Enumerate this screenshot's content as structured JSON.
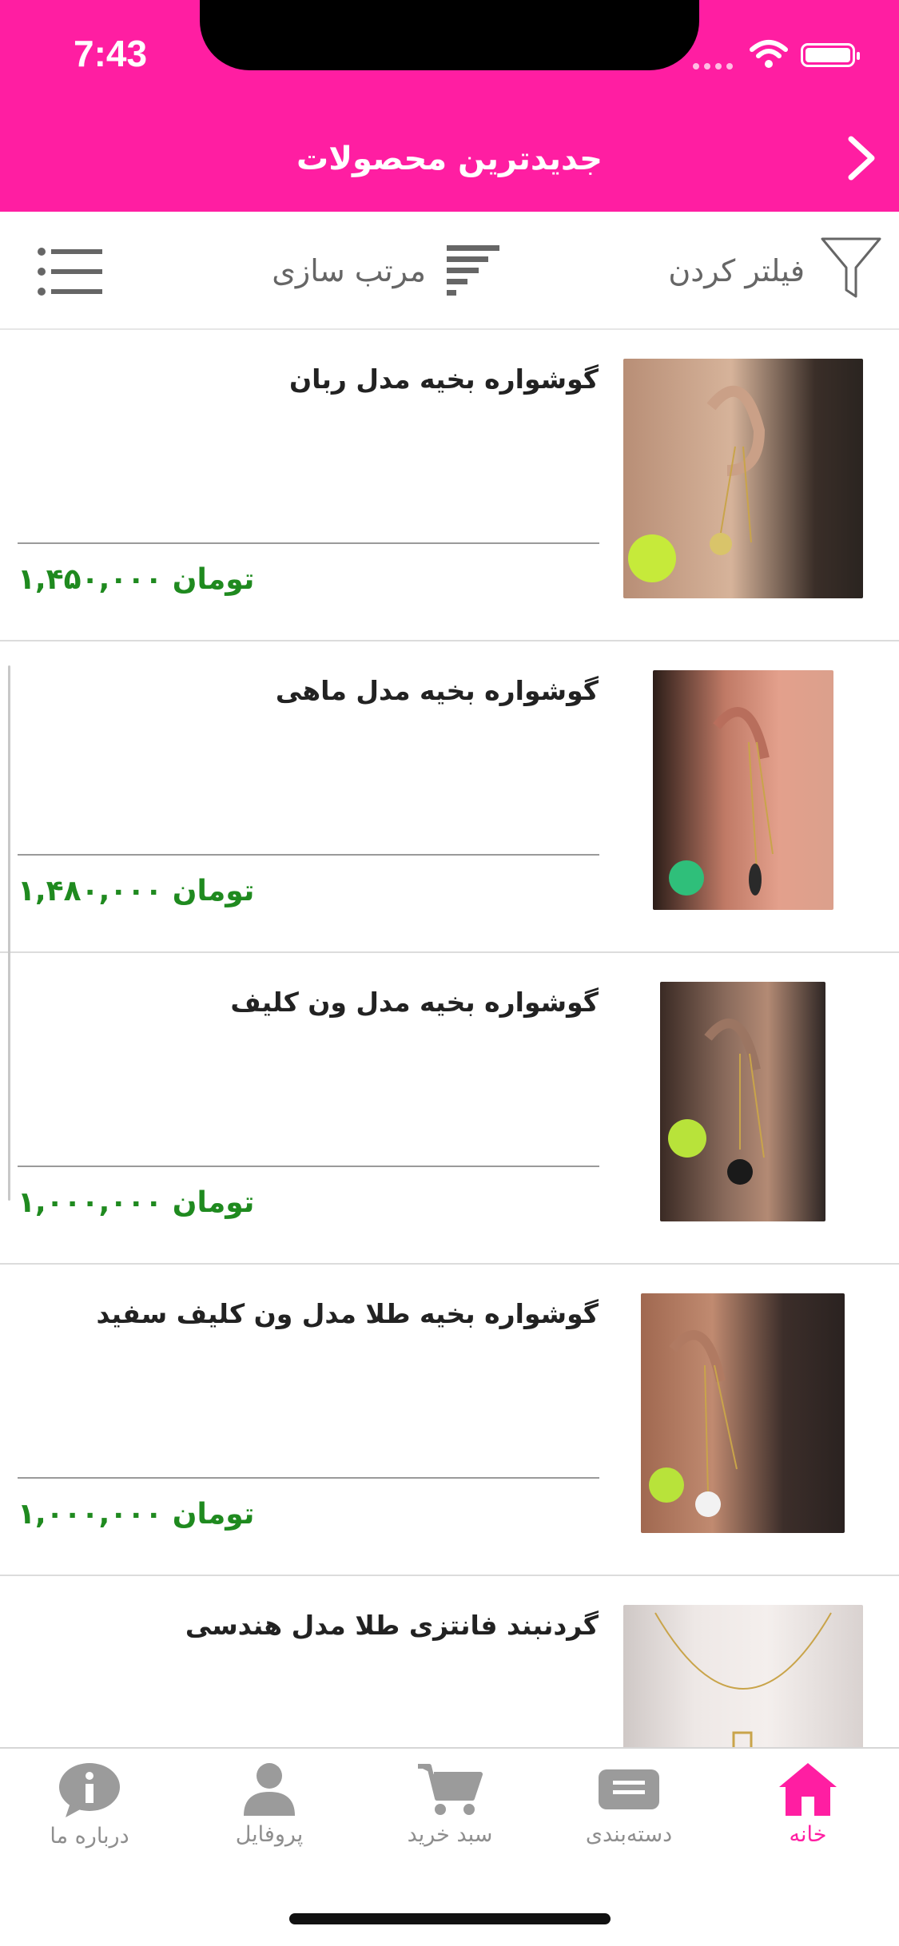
{
  "status_bar": {
    "time": "7:43"
  },
  "header": {
    "title": "جدیدترین محصولات"
  },
  "toolbar": {
    "filter_label": "فیلتر کردن",
    "sort_label": "مرتب سازی"
  },
  "products": [
    {
      "title": "گوشواره بخیه مدل ربان",
      "price": "۱,۴۵۰,۰۰۰",
      "currency": "تومان"
    },
    {
      "title": "گوشواره بخیه مدل ماهی",
      "price": "۱,۴۸۰,۰۰۰",
      "currency": "تومان"
    },
    {
      "title": "گوشواره بخیه مدل ون کلیف",
      "price": "۱,۰۰۰,۰۰۰",
      "currency": "تومان"
    },
    {
      "title": "گوشواره بخیه طلا مدل ون کلیف سفید",
      "price": "۱,۰۰۰,۰۰۰",
      "currency": "تومان"
    },
    {
      "title": "گردنبند فانتزی طلا مدل هندسی",
      "price": "",
      "currency": ""
    }
  ],
  "tabs": [
    {
      "label": "خانه",
      "icon": "home-icon"
    },
    {
      "label": "دسته‌بندی",
      "icon": "category-icon"
    },
    {
      "label": "سبد خرید",
      "icon": "cart-icon"
    },
    {
      "label": "پروفایل",
      "icon": "profile-icon"
    },
    {
      "label": "درباره ما",
      "icon": "info-icon"
    }
  ],
  "colors": {
    "brand": "#ff1ea2",
    "price": "#1f8a1f",
    "tab_inactive": "#8e8e8e"
  }
}
